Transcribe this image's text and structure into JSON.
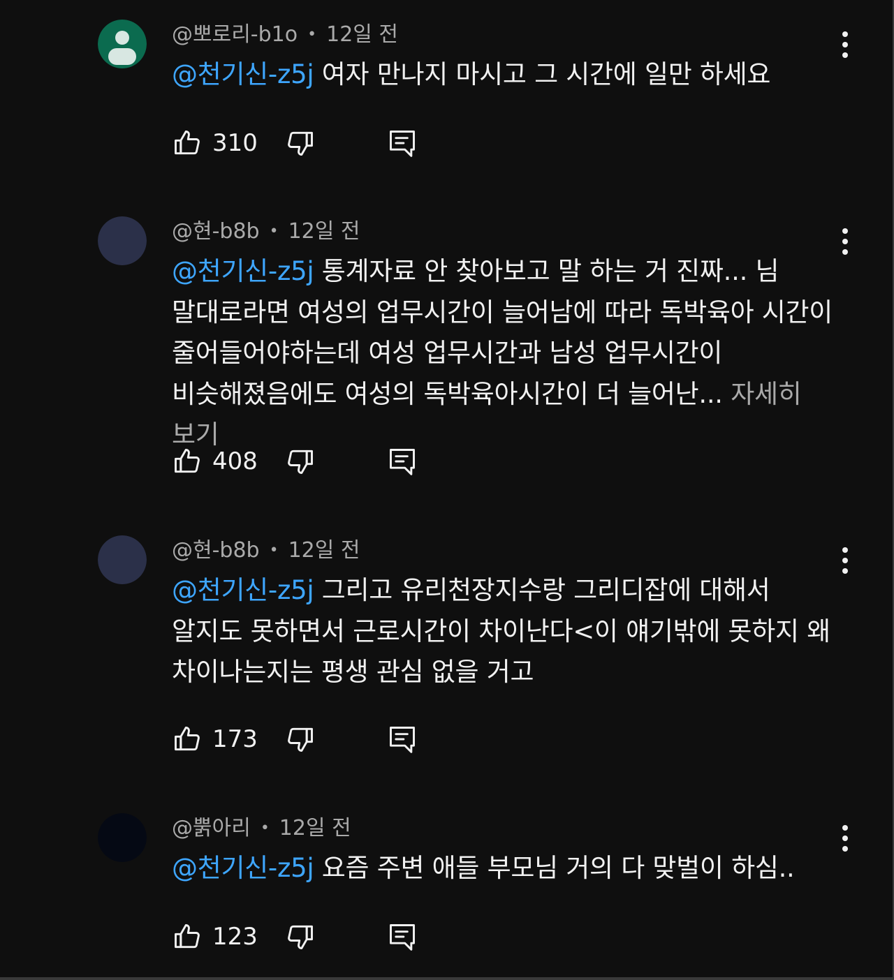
{
  "comments": [
    {
      "author": "@뽀로리-b1o",
      "time": "12일 전",
      "mention": "@천기신-z5j",
      "text": " 여자 만나지 마시고 그 시간에 일만 하세요",
      "read_more": "",
      "likes": "310",
      "avatar": {
        "type": "person-silhouette",
        "bg": "#0b6b4f",
        "fg": "#d8e7e2"
      }
    },
    {
      "author": "@현-b8b",
      "time": "12일 전",
      "mention": "@천기신-z5j",
      "text": "  통계자료 안 찾아보고 말 하는 거 진짜... 님 말대로라면 여성의 업무시간이 늘어남에 따라 독박육아 시간이 줄어들어야하는데 여성 업무시간과 남성 업무시간이 비슷해졌음에도 여성의 독박육아시간이 더 늘어난... ",
      "read_more": "자세히 보기",
      "likes": "408",
      "avatar": {
        "type": "solid",
        "bg": "#2b3049"
      }
    },
    {
      "author": "@현-b8b",
      "time": "12일 전",
      "mention": "@천기신-z5j",
      "text": " 그리고 유리천장지수랑 그리디잡에 대해서 알지도 못하면서 근로시간이 차이난다<이 얘기밖에 못하지 왜 차이나는지는 평생 관심 없을 거고",
      "read_more": "",
      "likes": "173",
      "avatar": {
        "type": "solid",
        "bg": "#2b3049"
      }
    },
    {
      "author": "@뿕아리",
      "time": "12일 전",
      "mention": "@천기신-z5j",
      "text": " 요즘 주변 애들 부모님 거의 다 맞벌이 하심..",
      "read_more": "",
      "likes": "123",
      "avatar": {
        "type": "solid",
        "bg": "#050914"
      }
    }
  ],
  "icons": {
    "like": "thumbs-up-icon",
    "dislike": "thumbs-down-icon",
    "reply": "reply-icon",
    "menu": "more-vertical-icon"
  },
  "colors": {
    "background": "#0f0f0f",
    "mention": "#3ea6ff",
    "text": "#f1f1f1",
    "meta": "#aaaaaa"
  }
}
